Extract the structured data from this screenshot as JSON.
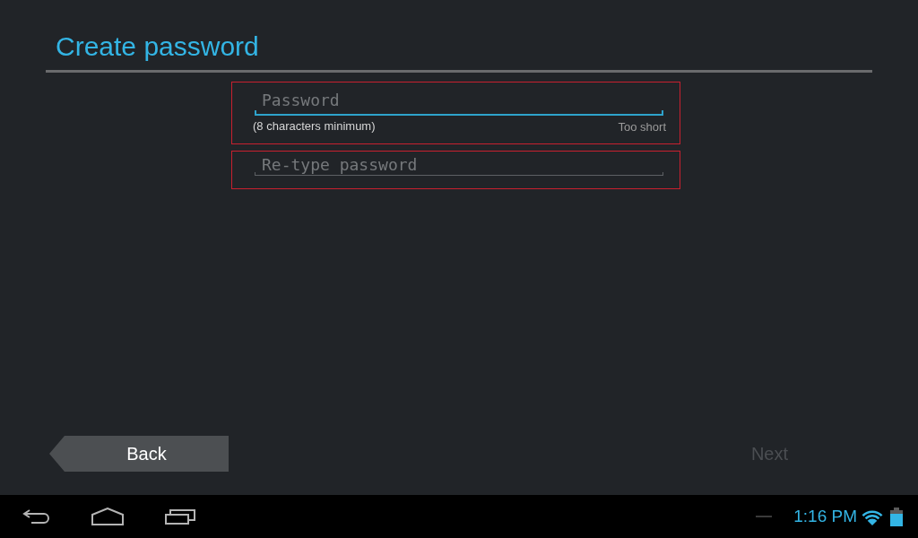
{
  "title": "Create password",
  "fields": [
    {
      "placeholder": "Password",
      "focused": true,
      "highlighted": true,
      "hint": "(8 characters minimum)",
      "status": "Too short"
    },
    {
      "placeholder": "Re-type password",
      "focused": false,
      "highlighted": true
    }
  ],
  "buttons": [
    {
      "label": "Back",
      "kind": "back",
      "disabled": false
    },
    {
      "label": "Next",
      "kind": "next",
      "disabled": true
    }
  ],
  "status_bar": {
    "time": "1:16 PM"
  }
}
